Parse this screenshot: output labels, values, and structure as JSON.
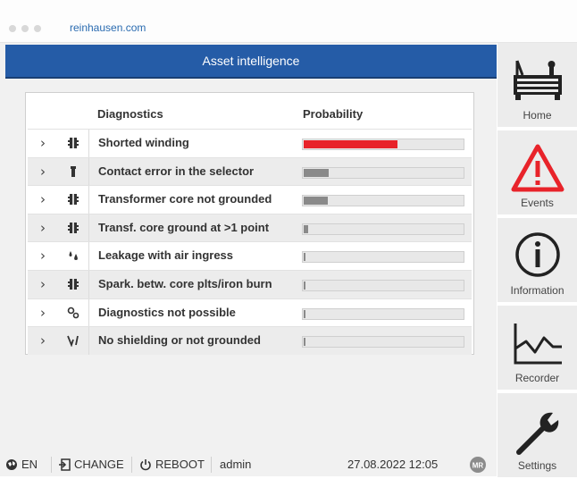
{
  "browser": {
    "url": "reinhausen.com"
  },
  "header": {
    "title": "Asset intelligence"
  },
  "table": {
    "col_diagnostics": "Diagnostics",
    "col_probability": "Probability",
    "rows": [
      {
        "label": "Shorted winding",
        "icon": "transformer-core-icon",
        "probability": 0.59,
        "color": "#e8232a"
      },
      {
        "label": "Contact error in the selector",
        "icon": "selector-contact-icon",
        "probability": 0.16,
        "color": "#8a8a8a"
      },
      {
        "label": "Transformer core not grounded",
        "icon": "transformer-core-icon",
        "probability": 0.15,
        "color": "#8a8a8a"
      },
      {
        "label": "Transf. core ground at >1 point",
        "icon": "transformer-core-icon",
        "probability": 0.03,
        "color": "#8a8a8a"
      },
      {
        "label": "Leakage with air ingress",
        "icon": "drops-icon",
        "probability": 0.01,
        "color": "#8a8a8a"
      },
      {
        "label": "Spark. betw. core plts/iron burn",
        "icon": "transformer-core-icon",
        "probability": 0.01,
        "color": "#8a8a8a"
      },
      {
        "label": "Diagnostics not possible",
        "icon": "gears-icon",
        "probability": 0.01,
        "color": "#8a8a8a"
      },
      {
        "label": "No shielding or not grounded",
        "icon": "shielding-icon",
        "probability": 0.01,
        "color": "#8a8a8a"
      }
    ]
  },
  "sidebar": {
    "home": "Home",
    "events": "Events",
    "information": "Information",
    "recorder": "Recorder",
    "settings": "Settings"
  },
  "footer": {
    "language": "EN",
    "change": "CHANGE",
    "reboot": "REBOOT",
    "user": "admin",
    "datetime": "27.08.2022 12:05",
    "logo": "MR"
  },
  "colors": {
    "accent": "#255ca7",
    "alert": "#e8232a"
  }
}
